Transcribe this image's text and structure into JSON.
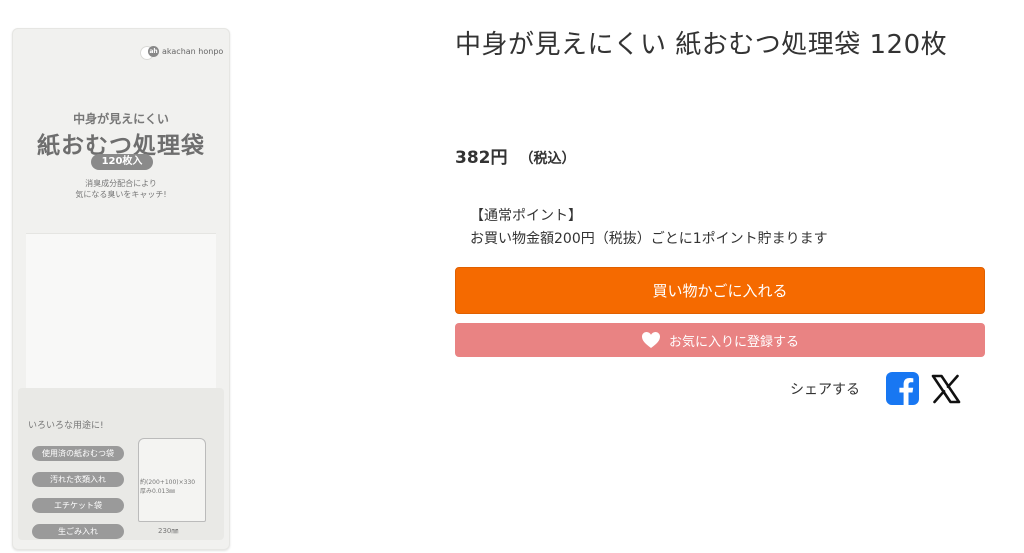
{
  "product": {
    "title": "中身が見えにくい 紙おむつ処理袋 120枚",
    "price": "382円",
    "tax_note": "（税込）"
  },
  "package": {
    "brand": "akachan honpo",
    "brand_mark": "ah",
    "subtitle": "中身が見えにくい",
    "title": "紙おむつ処理袋",
    "count": "120枚入",
    "desc_line1": "消臭成分配合により",
    "desc_line2": "気になる臭いをキャッチ!",
    "uses_title": "いろいろな用途に!",
    "uses": [
      "使用済の紙おむつ袋",
      "汚れた衣類入れ",
      "エチケット袋",
      "生ごみ入れ"
    ],
    "spec_line1": "約(200+100)×330",
    "spec_line2": "厚み0.013㎜",
    "width_label": "230㎜"
  },
  "points": {
    "heading": "【通常ポイント】",
    "detail": "お買い物金額200円（税抜）ごとに1ポイント貯まります"
  },
  "actions": {
    "cart_label": "買い物かごに入れる",
    "favorite_label": "お気に入りに登録する"
  },
  "share": {
    "label": "シェアする",
    "icons": [
      "facebook-icon",
      "x-icon"
    ]
  },
  "colors": {
    "cart": "#f56a00",
    "favorite": "#e98383",
    "facebook": "#1877f2"
  }
}
